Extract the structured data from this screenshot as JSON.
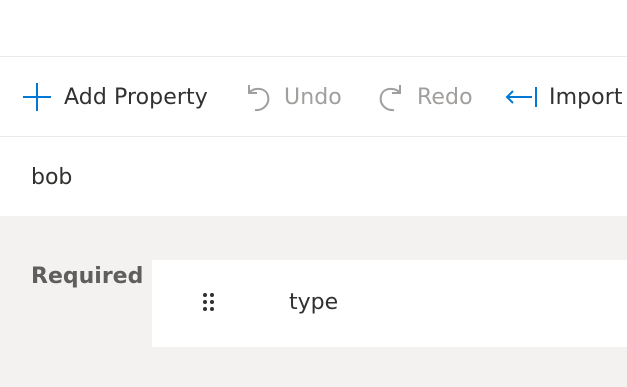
{
  "toolbar": {
    "add_property": {
      "label": "Add Property",
      "icon": "plus-icon",
      "enabled": true
    },
    "undo": {
      "label": "Undo",
      "icon": "undo-icon",
      "enabled": false
    },
    "redo": {
      "label": "Redo",
      "icon": "redo-icon",
      "enabled": false
    },
    "import": {
      "label": "Import",
      "icon": "import-icon",
      "enabled": true
    }
  },
  "schema": {
    "name": "bob",
    "required_label": "Required p",
    "dragging_item": {
      "label": "type",
      "icon": "drag-handle-icon"
    }
  },
  "colors": {
    "accent": "#0078d4",
    "text": "#323130",
    "disabled_text": "#a19f9d",
    "section_background": "#f3f2f1"
  }
}
